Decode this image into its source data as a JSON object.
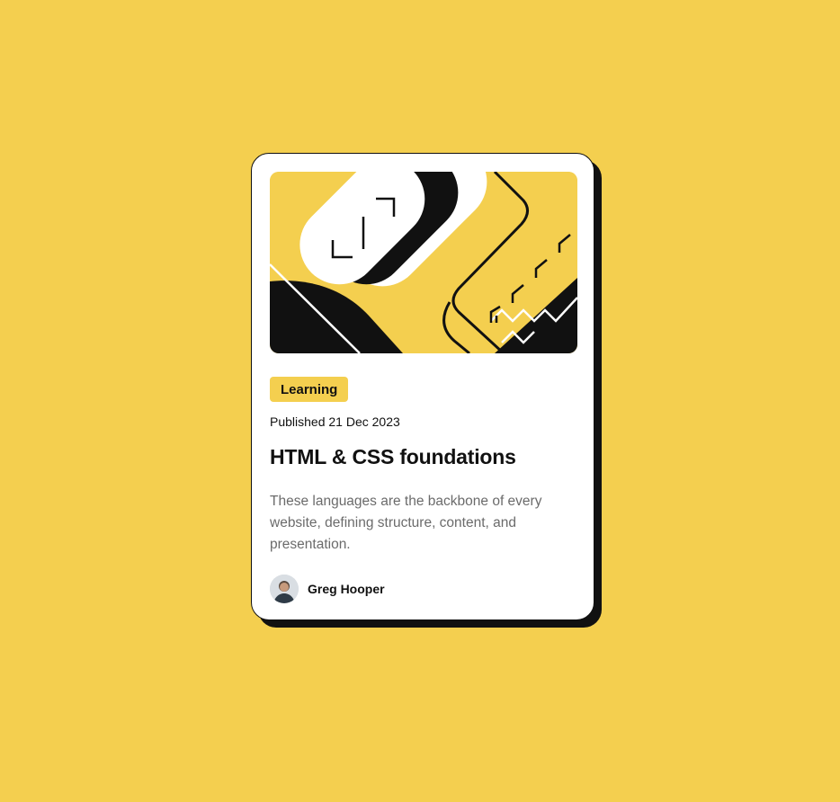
{
  "card": {
    "tag": "Learning",
    "published": "Published 21 Dec 2023",
    "title": "HTML & CSS foundations",
    "description": "These languages are the backbone of every website, defining structure, content, and presentation.",
    "author": {
      "name": "Greg Hooper",
      "avatar_icon": "person-avatar"
    },
    "hero_icon": "abstract-illustration"
  },
  "colors": {
    "background": "#F4CF4F",
    "card": "#FFFFFF",
    "ink": "#111111",
    "muted_text": "#6B6B6B",
    "tag_bg": "#F4CF4F"
  }
}
